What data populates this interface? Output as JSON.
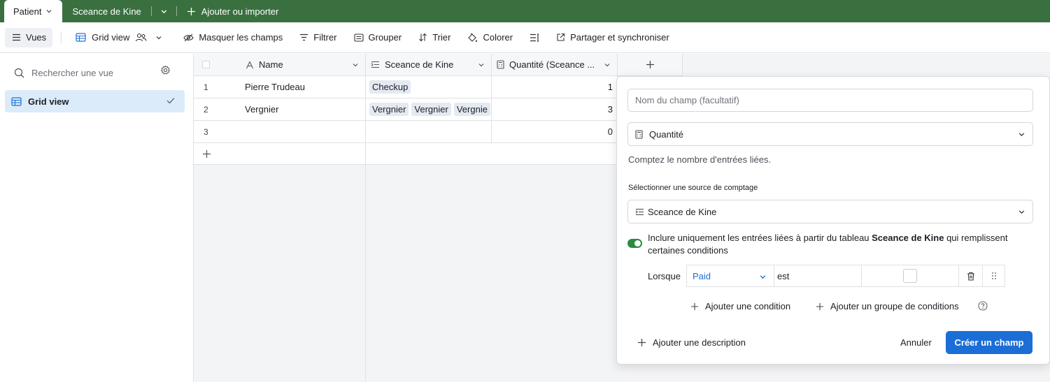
{
  "tabs": {
    "active": "Patient",
    "second": "Sceance de Kine",
    "add": "Ajouter ou importer"
  },
  "toolbar": {
    "views": "Vues",
    "view_name": "Grid view",
    "hide_fields": "Masquer les champs",
    "filter": "Filtrer",
    "group": "Grouper",
    "sort": "Trier",
    "color": "Colorer",
    "share": "Partager et synchroniser"
  },
  "sidebar": {
    "search_placeholder": "Rechercher une vue",
    "views": [
      {
        "label": "Grid view"
      }
    ]
  },
  "grid": {
    "columns": [
      "Name",
      "Sceance de Kine",
      "Quantité (Sceance ..."
    ],
    "rows": [
      {
        "num": "1",
        "name": "Pierre Trudeau",
        "links": [
          "Checkup"
        ],
        "qty": "1"
      },
      {
        "num": "2",
        "name": "Vergnier",
        "links": [
          "Vergnier",
          "Vergnier",
          "Vergnie"
        ],
        "qty": "3"
      },
      {
        "num": "3",
        "name": "",
        "links": [],
        "qty": "0"
      }
    ]
  },
  "panel": {
    "name_placeholder": "Nom du champ (facultatif)",
    "field_type": "Quantité",
    "description": "Comptez le nombre d'entrées liées.",
    "source_label": "Sélectionner une source de comptage",
    "source_value": "Sceance de Kine",
    "include_prefix": "Inclure uniquement les entrées liées à partir du tableau ",
    "include_table": "Sceance de Kine",
    "include_suffix": " qui remplissent certaines conditions",
    "condition": {
      "when": "Lorsque",
      "field": "Paid",
      "operator": "est"
    },
    "add_condition": "Ajouter une condition",
    "add_group": "Ajouter un groupe de conditions",
    "add_description": "Ajouter une description",
    "cancel": "Annuler",
    "create": "Créer un champ"
  },
  "colors": {
    "tabbar": "#3a7040",
    "primary": "#1b6ed6",
    "toggle": "#2a8a3e",
    "selected_view": "#dcebfa"
  }
}
